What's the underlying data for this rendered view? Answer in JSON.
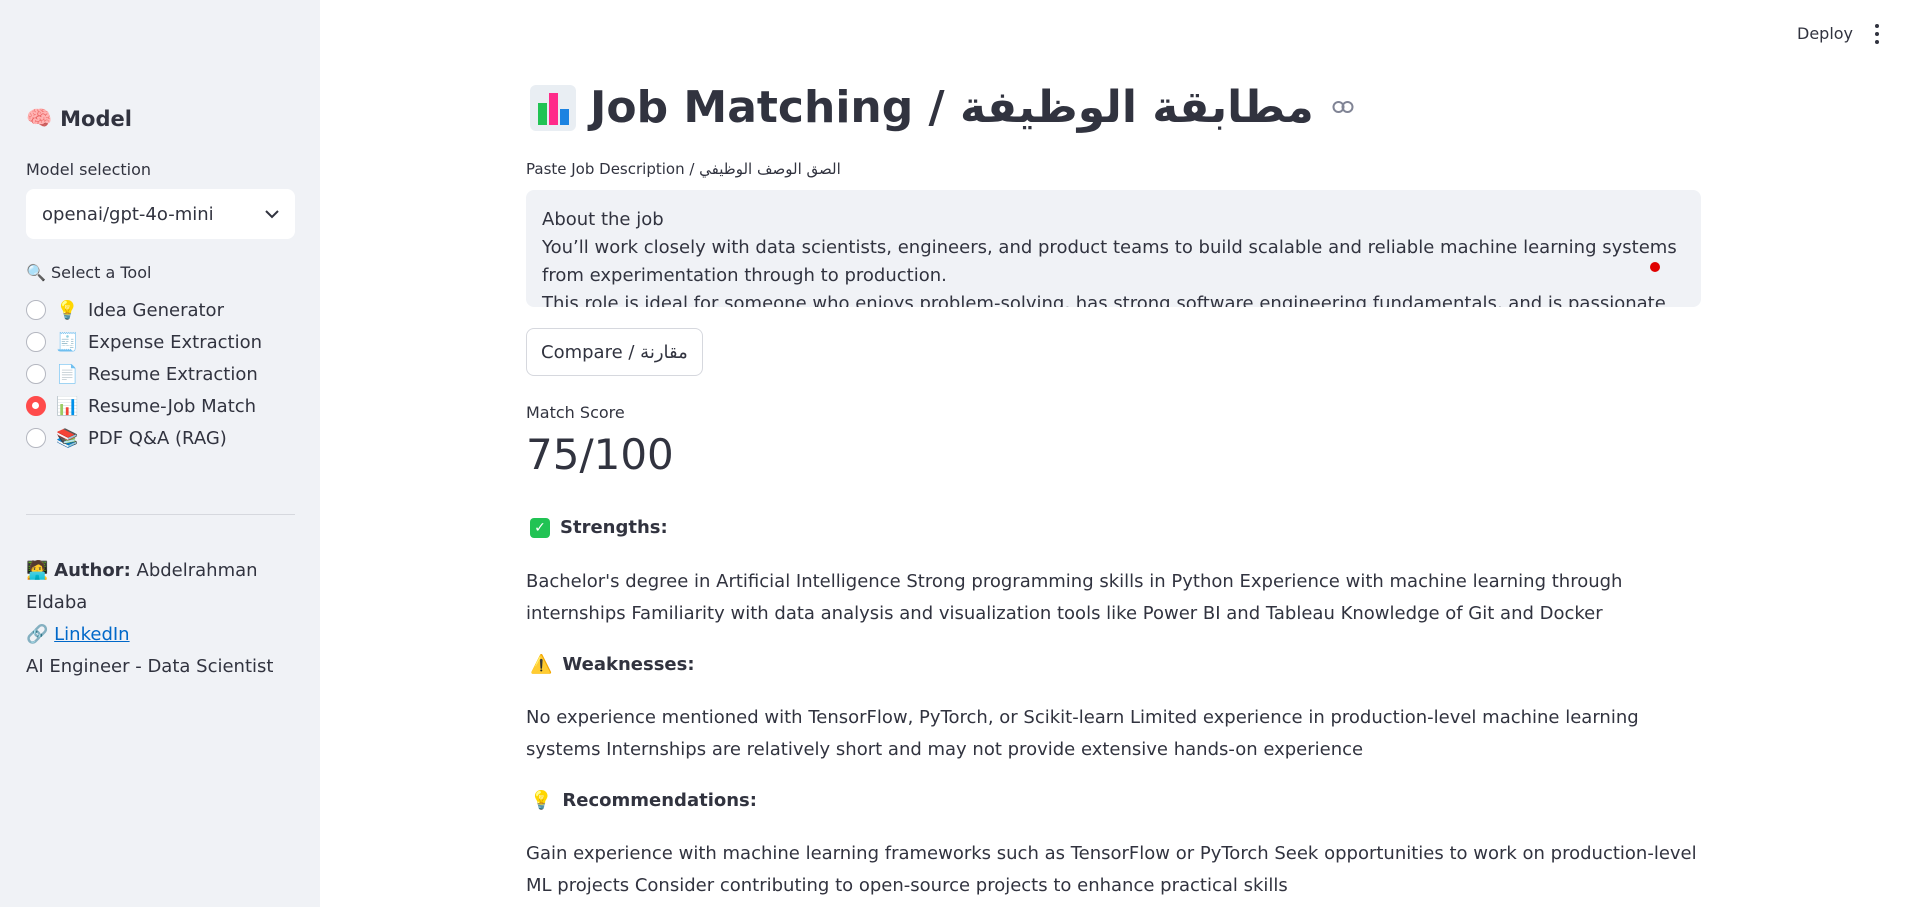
{
  "sidebar": {
    "header_icon": "🧠",
    "header": "Model",
    "model_label": "Model selection",
    "model_value": "openai/gpt-4o-mini",
    "tool_label": "🔍 Select a Tool",
    "tools": [
      {
        "emoji": "💡",
        "label": "Idea Generator",
        "selected": false
      },
      {
        "emoji": "🧾",
        "label": "Expense Extraction",
        "selected": false
      },
      {
        "emoji": "📄",
        "label": "Resume Extraction",
        "selected": false
      },
      {
        "emoji": "📊",
        "label": "Resume-Job Match",
        "selected": true
      },
      {
        "emoji": "📚",
        "label": "PDF Q&A (RAG)",
        "selected": false
      }
    ],
    "author_icon": "🧑‍💻",
    "author_label": "Author:",
    "author_name": "Abdelrahman Eldaba",
    "link_icon": "🔗",
    "link_text": "LinkedIn",
    "role": "AI Engineer - Data Scientist"
  },
  "topbar": {
    "deploy_label": "Deploy"
  },
  "main": {
    "title": "Job Matching / مطابقة الوظيفة",
    "jd_label": "Paste Job Description / الصق الوصف الوظيفي",
    "jd_value": "About the job\nYou’ll work closely with data scientists, engineers, and product teams to build scalable and reliable machine learning systems from experimentation through to production.\nThis role is ideal for someone who enjoys problem-solving, has strong software engineering fundamentals, and is passionate about",
    "compare_label": "Compare / مقارنة",
    "metric_label": "Match Score",
    "metric_value": "75/100",
    "strengths_title": "Strengths:",
    "strengths_body": "Bachelor's degree in Artificial Intelligence Strong programming skills in Python Experience with machine learning through internships Familiarity with data analysis and visualization tools like Power BI and Tableau Knowledge of Git and Docker",
    "weaknesses_icon": "⚠️",
    "weaknesses_title": "Weaknesses:",
    "weaknesses_body": "No experience mentioned with TensorFlow, PyTorch, or Scikit-learn Limited experience in production-level machine learning systems Internships are relatively short and may not provide extensive hands-on experience",
    "recommendations_icon": "💡",
    "recommendations_title": "Recommendations:",
    "recommendations_body": "Gain experience with machine learning frameworks such as TensorFlow or PyTorch Seek opportunities to work on production-level ML projects Consider contributing to open-source projects to enhance practical skills"
  }
}
